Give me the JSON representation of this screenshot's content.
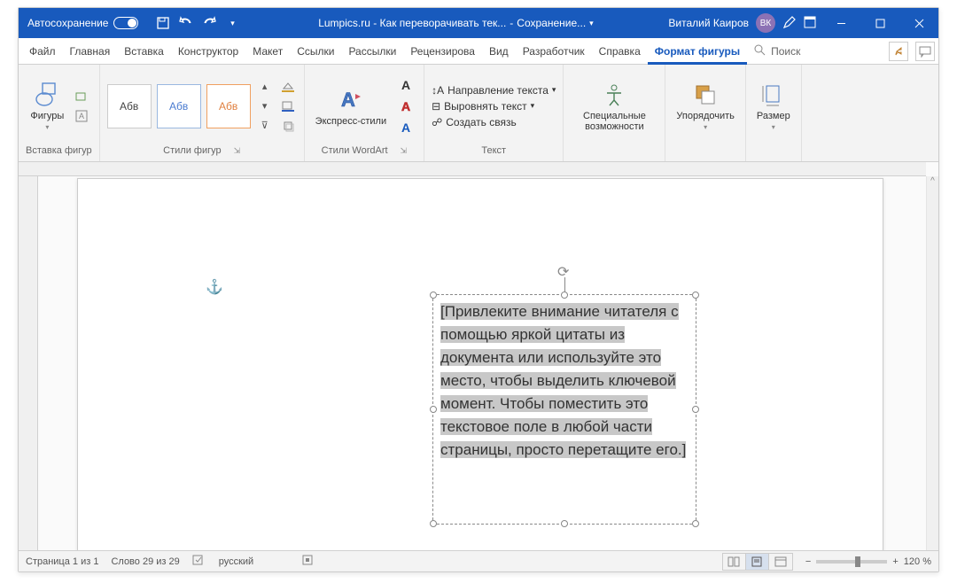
{
  "titlebar": {
    "autosave": "Автосохранение",
    "doc_title": "Lumpics.ru - Как переворачивать тек...",
    "save_status": "Сохранение...",
    "user_name": "Виталий Каиров",
    "user_initials": "ВК"
  },
  "tabs": {
    "file": "Файл",
    "home": "Главная",
    "insert": "Вставка",
    "design": "Конструктор",
    "layout": "Макет",
    "references": "Ссылки",
    "mailings": "Рассылки",
    "review": "Рецензирова",
    "view": "Вид",
    "developer": "Разработчик",
    "help": "Справка",
    "shapeformat": "Формат фигуры",
    "search": "Поиск"
  },
  "ribbon": {
    "insert_shapes": {
      "shapes": "Фигуры",
      "label": "Вставка фигур"
    },
    "shape_styles": {
      "sample": "Абв",
      "label": "Стили фигур"
    },
    "wordart": {
      "express": "Экспресс-стили",
      "label": "Стили WordArt"
    },
    "textgrp": {
      "direction": "Направление текста",
      "align": "Выровнять текст",
      "link": "Создать связь",
      "label": "Текст"
    },
    "accessibility": {
      "btn": "Специальные возможности",
      "label": ""
    },
    "arrange": {
      "btn": "Упорядочить"
    },
    "size": {
      "btn": "Размер"
    }
  },
  "document": {
    "textbox_content": "[Привлеките внимание читателя с помощью яркой цитаты из документа или используйте это место, чтобы выделить ключевой момент. Чтобы поместить это текстовое поле в любой части страницы, просто перетащите его.]"
  },
  "statusbar": {
    "page": "Страница 1 из 1",
    "words": "Слово 29 из 29",
    "lang": "русский",
    "zoom": "120 %"
  }
}
